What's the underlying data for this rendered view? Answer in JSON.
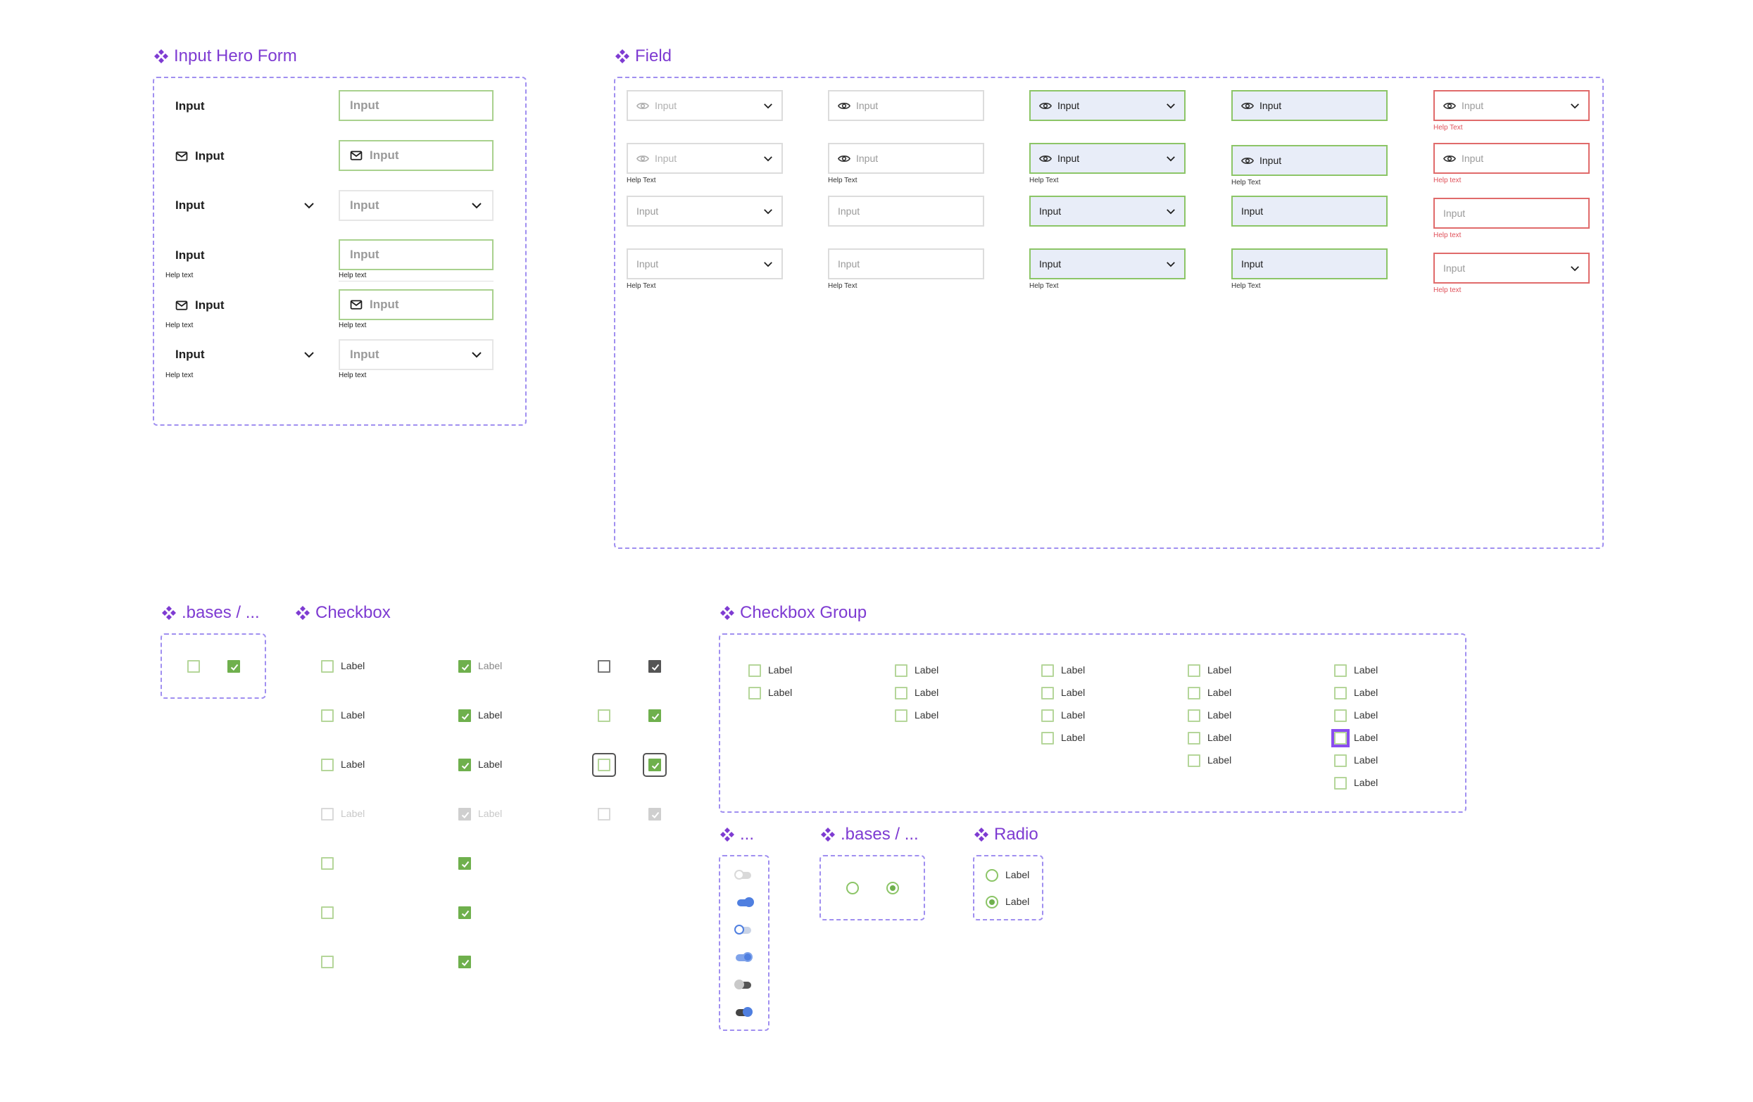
{
  "sections": {
    "input_hero_form": "Input Hero Form",
    "field": "Field",
    "bases_1": ".bases / ...",
    "checkbox": "Checkbox",
    "checkbox_group": "Checkbox Group",
    "toggle": "...",
    "bases_2": ".bases / ...",
    "radio": "Radio"
  },
  "hero": {
    "label": "Input",
    "placeholder": "Input",
    "help": "Help text"
  },
  "field": {
    "placeholder": "Input",
    "value": "Input",
    "help": "Help Text",
    "help_lower": "Help text"
  },
  "checkbox": {
    "label": "Label"
  },
  "colors": {
    "accent": "#7e3bd2",
    "success": "#6fb04d",
    "error": "#e0515a",
    "active_bg": "#e8edf8",
    "toggle_on": "#4f7fe0"
  }
}
